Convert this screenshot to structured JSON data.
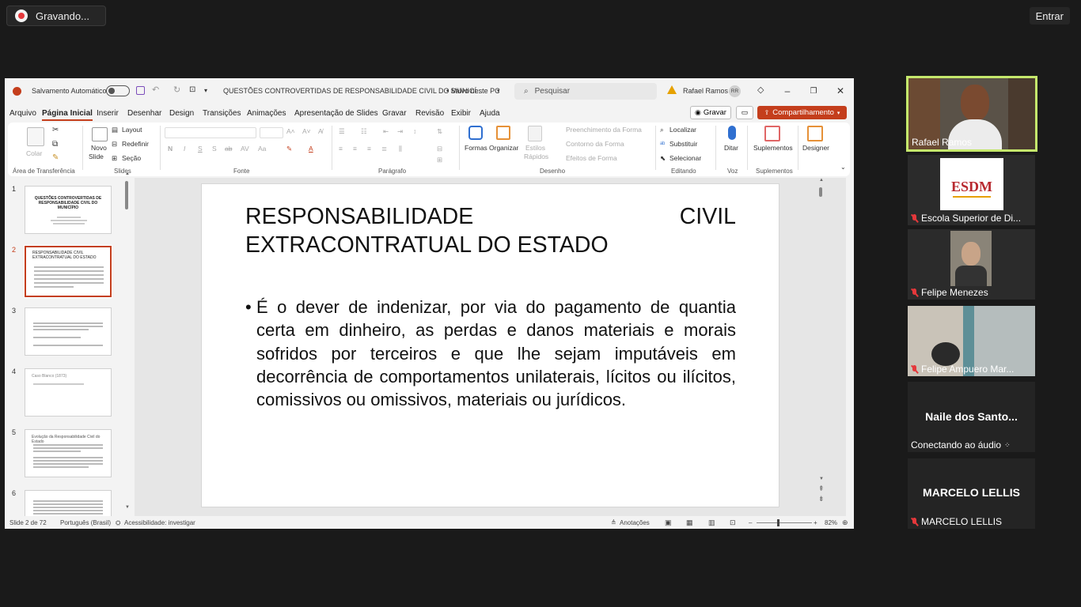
{
  "zoom": {
    "recording_label": "Gravando...",
    "enter_label": "Entrar"
  },
  "ppt": {
    "titlebar": {
      "autosave_label": "Salvamento Automático",
      "doc_title": "QUESTÕES CONTROVERTIDAS DE RESPONSABILIDADE CIVIL DO MUNICÍ...",
      "save_status": "• Salvo neste PC",
      "search_placeholder": "Pesquisar",
      "user_name": "Rafael Ramos",
      "user_initials": "RR"
    },
    "menu": [
      "Arquivo",
      "Página Inicial",
      "Inserir",
      "Desenhar",
      "Design",
      "Transições",
      "Animações",
      "Apresentação de Slides",
      "Gravar",
      "Revisão",
      "Exibir",
      "Ajuda"
    ],
    "record_btn": "Gravar",
    "share_btn": "Compartilhamento",
    "ribbon": {
      "paste": "Colar",
      "clipboard_group": "Área de Transferência",
      "new_slide_1": "Novo",
      "new_slide_2": "Slide",
      "layout": "Layout",
      "reset": "Redefinir",
      "section": "Seção",
      "slides_group": "Slides",
      "font_group": "Fonte",
      "paragraph_group": "Parágrafo",
      "shapes": "Formas",
      "arrange": "Organizar",
      "quick_styles_1": "Estilos",
      "quick_styles_2": "Rápidos",
      "shape_fill": "Preenchimento da Forma",
      "shape_outline": "Contorno da Forma",
      "shape_effects": "Efeitos de Forma",
      "drawing_group": "Desenho",
      "find": "Localizar",
      "replace": "Substituir",
      "select": "Selecionar",
      "editing_group": "Editando",
      "dictate": "Ditar",
      "voice_group": "Voz",
      "addins": "Suplementos",
      "addins_group": "Suplementos",
      "designer": "Designer"
    },
    "thumbnails": [
      {
        "num": "1",
        "title": "QUESTÕES CONTROVERTIDAS DE RESPONSABILIDADE CIVIL DO MUNICÍPIO"
      },
      {
        "num": "2",
        "title": "RESPONSABILIDADE CIVIL EXTRACONTRATUAL DO ESTADO"
      },
      {
        "num": "3",
        "title": ""
      },
      {
        "num": "4",
        "title": "Caso Blanco (1873)"
      },
      {
        "num": "5",
        "title": "Evolução da Responsabilidade Civil do Estado"
      },
      {
        "num": "6",
        "title": ""
      }
    ],
    "slide": {
      "title": "RESPONSABILIDADE CIVIL EXTRACONTRATUAL DO ESTADO",
      "bullet": "É o dever de indenizar, por via do pagamento de quantia certa em dinheiro, as perdas e danos materiais e morais sofridos por terceiros e que lhe sejam imputáveis em decorrência de comportamentos unilaterais, lícitos ou ilícitos, comissivos ou omissivos, materiais ou jurídicos."
    },
    "status": {
      "slide_count": "Slide 2 de 72",
      "language": "Português (Brasil)",
      "accessibility": "Acessibilidade: investigar",
      "notes": "Anotações",
      "zoom": "82%"
    }
  },
  "participants": [
    {
      "name": "Rafael Ramos",
      "muted": false
    },
    {
      "name": "Escola Superior de Di...",
      "muted": true,
      "logo": "ESDM"
    },
    {
      "name": "Felipe Menezes",
      "muted": true
    },
    {
      "name": "Felipe Ampuero Mar...",
      "muted": true
    },
    {
      "name": "Naile dos Santo...",
      "status": "Conectando ao áudio"
    },
    {
      "name": "MARCELO LELLIS",
      "muted": true
    }
  ],
  "colors": {
    "ppt_accent": "#c43e1c",
    "zoom_bg": "#1a1a1a",
    "active_speaker_border": "#c5e86c"
  }
}
